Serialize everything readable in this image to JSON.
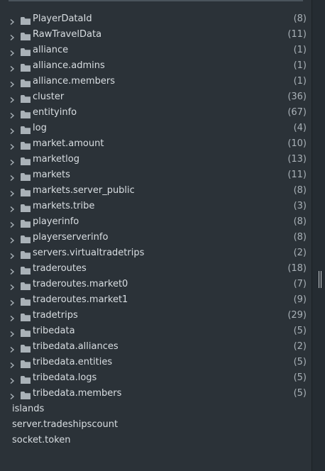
{
  "tree": {
    "folders": [
      {
        "name": "PlayerDataId",
        "count": "(8)"
      },
      {
        "name": "RawTravelData",
        "count": "(11)"
      },
      {
        "name": "alliance",
        "count": "(1)"
      },
      {
        "name": "alliance.admins",
        "count": "(1)"
      },
      {
        "name": "alliance.members",
        "count": "(1)"
      },
      {
        "name": "cluster",
        "count": "(36)"
      },
      {
        "name": "entityinfo",
        "count": "(67)"
      },
      {
        "name": "log",
        "count": "(4)"
      },
      {
        "name": "market.amount",
        "count": "(10)"
      },
      {
        "name": "marketlog",
        "count": "(13)"
      },
      {
        "name": "markets",
        "count": "(11)"
      },
      {
        "name": "markets.server_public",
        "count": "(8)"
      },
      {
        "name": "markets.tribe",
        "count": "(3)"
      },
      {
        "name": "playerinfo",
        "count": "(8)"
      },
      {
        "name": "playerserverinfo",
        "count": "(8)"
      },
      {
        "name": "servers.virtualtradetrips",
        "count": "(2)"
      },
      {
        "name": "traderoutes",
        "count": "(18)"
      },
      {
        "name": "traderoutes.market0",
        "count": "(7)"
      },
      {
        "name": "traderoutes.market1",
        "count": "(9)"
      },
      {
        "name": "tradetrips",
        "count": "(29)"
      },
      {
        "name": "tribedata",
        "count": "(5)"
      },
      {
        "name": "tribedata.alliances",
        "count": "(2)"
      },
      {
        "name": "tribedata.entities",
        "count": "(5)"
      },
      {
        "name": "tribedata.logs",
        "count": "(5)"
      },
      {
        "name": "tribedata.members",
        "count": "(5)"
      }
    ],
    "keys": [
      {
        "name": "islands"
      },
      {
        "name": "server.tradeshipscount"
      },
      {
        "name": "socket.token"
      }
    ]
  },
  "icons": {
    "expand": "chevron-right-icon",
    "folder": "folder-icon"
  },
  "colors": {
    "panel_background": "#2b3238",
    "text": "#d9dee2",
    "count_text": "#a9b1b7",
    "icon": "#aab2b8"
  }
}
